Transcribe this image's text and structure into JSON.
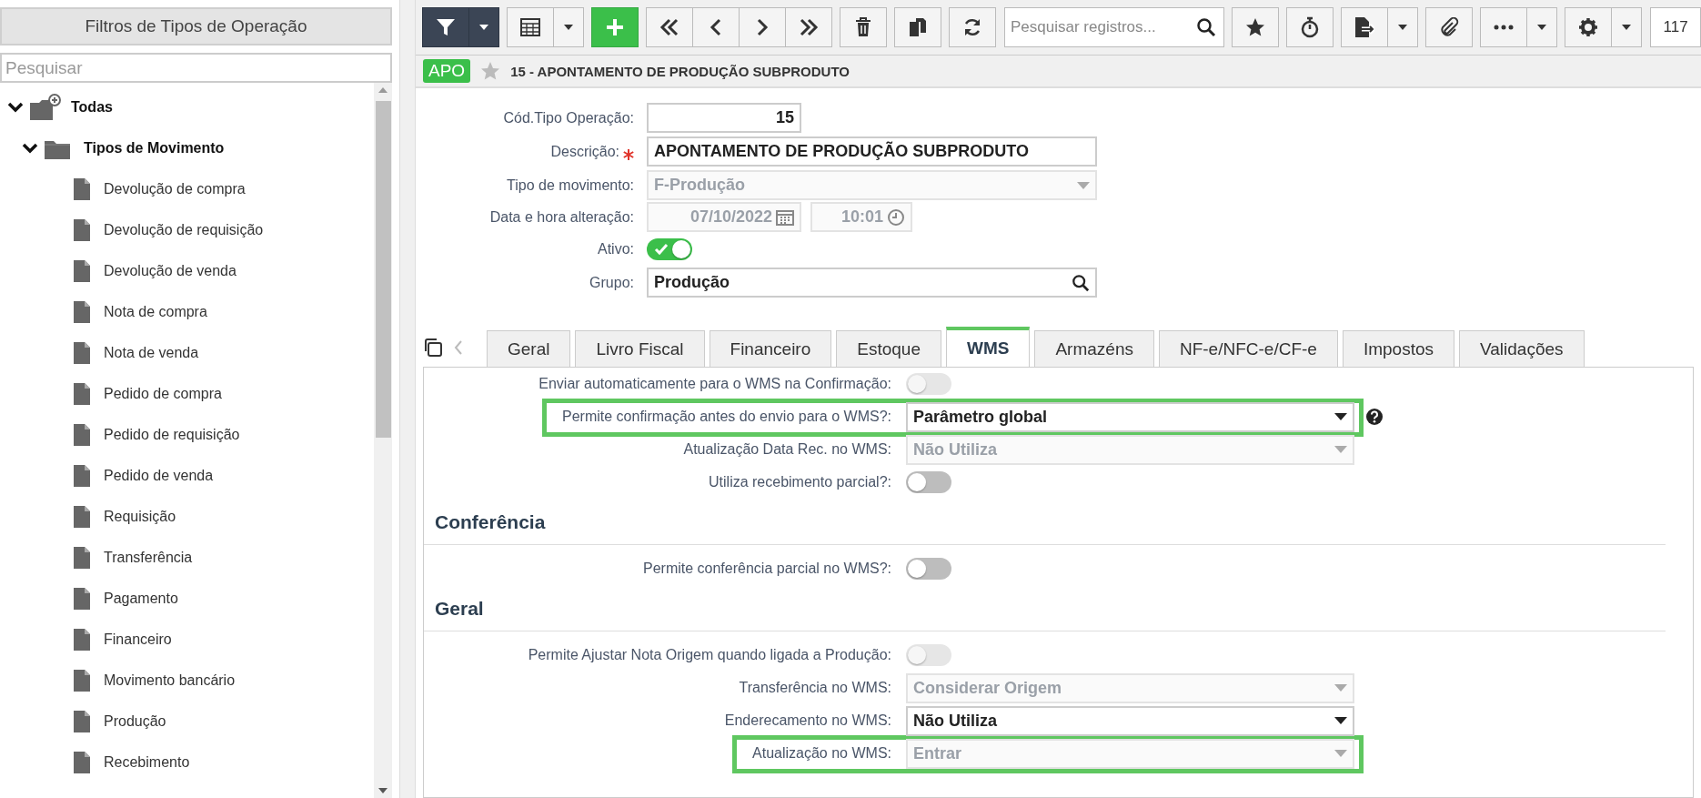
{
  "sidebar": {
    "title": "Filtros de Tipos de Operação",
    "search": {
      "placeholder": "Pesquisar"
    },
    "tree": [
      {
        "label": "Todas",
        "kind": "root",
        "expanded": true,
        "children": [
          {
            "label": "Tipos de Movimento",
            "kind": "folder",
            "expanded": true,
            "children": [
              {
                "label": "Devolução de compra",
                "kind": "file"
              },
              {
                "label": "Devolução de requisição",
                "kind": "file"
              },
              {
                "label": "Devolução de venda",
                "kind": "file"
              },
              {
                "label": "Nota de compra",
                "kind": "file"
              },
              {
                "label": "Nota de venda",
                "kind": "file"
              },
              {
                "label": "Pedido de compra",
                "kind": "file"
              },
              {
                "label": "Pedido de requisição",
                "kind": "file"
              },
              {
                "label": "Pedido de venda",
                "kind": "file"
              },
              {
                "label": "Requisição",
                "kind": "file"
              },
              {
                "label": "Transferência",
                "kind": "file"
              },
              {
                "label": "Pagamento",
                "kind": "file"
              },
              {
                "label": "Financeiro",
                "kind": "file"
              },
              {
                "label": "Movimento bancário",
                "kind": "file"
              },
              {
                "label": "Produção",
                "kind": "file"
              },
              {
                "label": "Recebimento",
                "kind": "file"
              }
            ]
          }
        ]
      }
    ]
  },
  "toolbar": {
    "search": {
      "placeholder": "Pesquisar registros..."
    },
    "count": "117"
  },
  "record": {
    "badge": "APO",
    "favorite": false,
    "title": "15 - APONTAMENTO DE PRODUÇÃO SUBPRODUTO"
  },
  "form": [
    {
      "kind": "number",
      "label": "Cód.Tipo Operação:",
      "value": "15",
      "disabled": false
    },
    {
      "kind": "text",
      "label": "Descrição:",
      "value": "APONTAMENTO DE PRODUÇÃO SUBPRODUTO",
      "required": true,
      "disabled": false
    },
    {
      "kind": "select",
      "label": "Tipo de movimento:",
      "value": "F-Produção",
      "disabled": true
    },
    {
      "kind": "datetime",
      "label": "Data e hora alteração:",
      "date": "07/10/2022",
      "time": "10:01",
      "disabled": true
    },
    {
      "kind": "toggle",
      "label": "Ativo:",
      "on": true,
      "disabled": false
    },
    {
      "kind": "lookup",
      "label": "Grupo:",
      "value": "Produção",
      "disabled": false
    }
  ],
  "tabs": [
    {
      "label": "Geral",
      "selected": false
    },
    {
      "label": "Livro Fiscal",
      "selected": false
    },
    {
      "label": "Financeiro",
      "selected": false
    },
    {
      "label": "Estoque",
      "selected": false
    },
    {
      "label": "WMS",
      "selected": true
    },
    {
      "label": "Armazéns",
      "selected": false
    },
    {
      "label": "NF-e/NFC-e/CF-e",
      "selected": false
    },
    {
      "label": "Impostos",
      "selected": false
    },
    {
      "label": "Validações",
      "selected": false
    }
  ],
  "tab_content": {
    "rows": [
      {
        "kind": "toggle",
        "label": "Enviar automaticamente para o WMS na Confirmação:",
        "on": false,
        "disabled": true
      },
      {
        "kind": "select",
        "label": "Permite confirmação antes do envio para o WMS?:",
        "value": "Parâmetro global",
        "disabled": false,
        "highlighted": true,
        "help": true
      },
      {
        "kind": "select",
        "label": "Atualização Data Rec. no WMS:",
        "value": "Não Utiliza",
        "disabled": true
      },
      {
        "kind": "toggle",
        "label": "Utiliza recebimento parcial?:",
        "on": false,
        "disabled": false
      },
      {
        "kind": "heading",
        "label": "Conferência"
      },
      {
        "kind": "toggle",
        "label": "Permite conferência parcial no WMS?:",
        "on": false,
        "disabled": false
      },
      {
        "kind": "heading",
        "label": "Geral"
      },
      {
        "kind": "toggle",
        "label": "Permite Ajustar Nota Origem quando ligada a Produção:",
        "on": false,
        "disabled": true
      },
      {
        "kind": "select",
        "label": "Transferência no WMS:",
        "value": "Considerar Origem",
        "disabled": true
      },
      {
        "kind": "select",
        "label": "Enderecamento no WMS:",
        "value": "Não Utiliza",
        "disabled": false
      },
      {
        "kind": "select",
        "label": "Atualização no WMS:",
        "value": "Entrar",
        "disabled": true,
        "highlighted": true
      }
    ]
  }
}
